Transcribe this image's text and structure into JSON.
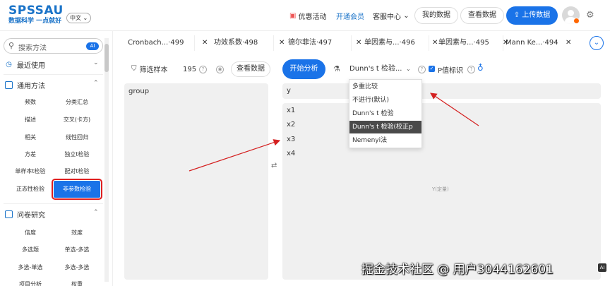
{
  "header": {
    "logo_main": "SPSSAU",
    "logo_sub": "数据科学 一点就好",
    "language": "中文",
    "promo": "优惠活动",
    "vip": "开通会员",
    "service": "客服中心",
    "my_data": "我的数据",
    "view_data": "查看数据",
    "upload": "上传数据"
  },
  "sidebar": {
    "search_placeholder": "搜索方法",
    "ai_badge": "AI",
    "recent": "最近使用",
    "common": "通用方法",
    "methods": [
      "频数",
      "分类汇总",
      "描述",
      "交叉(卡方)",
      "相关",
      "线性回归",
      "方差",
      "独立t检验",
      "单样本t检验",
      "配对t检验",
      "正态性检验",
      "非参数检验"
    ],
    "survey": "问卷研究",
    "survey_methods": [
      "信度",
      "效度",
      "多选题",
      "单选-多选",
      "多选-单选",
      "多选-多选",
      "项目分析",
      "权重"
    ]
  },
  "tabs": [
    "Cronbach...·499",
    "功效系数·498",
    "德尔菲法·497",
    "单因素与...·496",
    "单因素与...·495",
    "Mann Ke...·494"
  ],
  "toolbar": {
    "filter": "筛选样本",
    "count": "195",
    "view_data": "查看数据",
    "start": "开始分析",
    "method_select": "Dunn's t 检验...",
    "p_label": "P值标识"
  },
  "panels": {
    "group_title": "group",
    "y_title": "y",
    "x_items": [
      "x1",
      "x2",
      "x3",
      "x4"
    ],
    "x_hint": "Y(定量)"
  },
  "dropdown": {
    "options": [
      "多重比较",
      "不进行(默认)",
      "Dunn's t 检验",
      "Dunn's t 检验(校正p值)",
      "Nemenyi法"
    ],
    "selected_index": 3
  },
  "watermark": "掘金技术社区 @ 用户3044162601",
  "watermark_ai": "AI",
  "colors": {
    "accent": "#1a73e8",
    "highlight_outline": "#e02020",
    "arrow": "#d42020"
  }
}
